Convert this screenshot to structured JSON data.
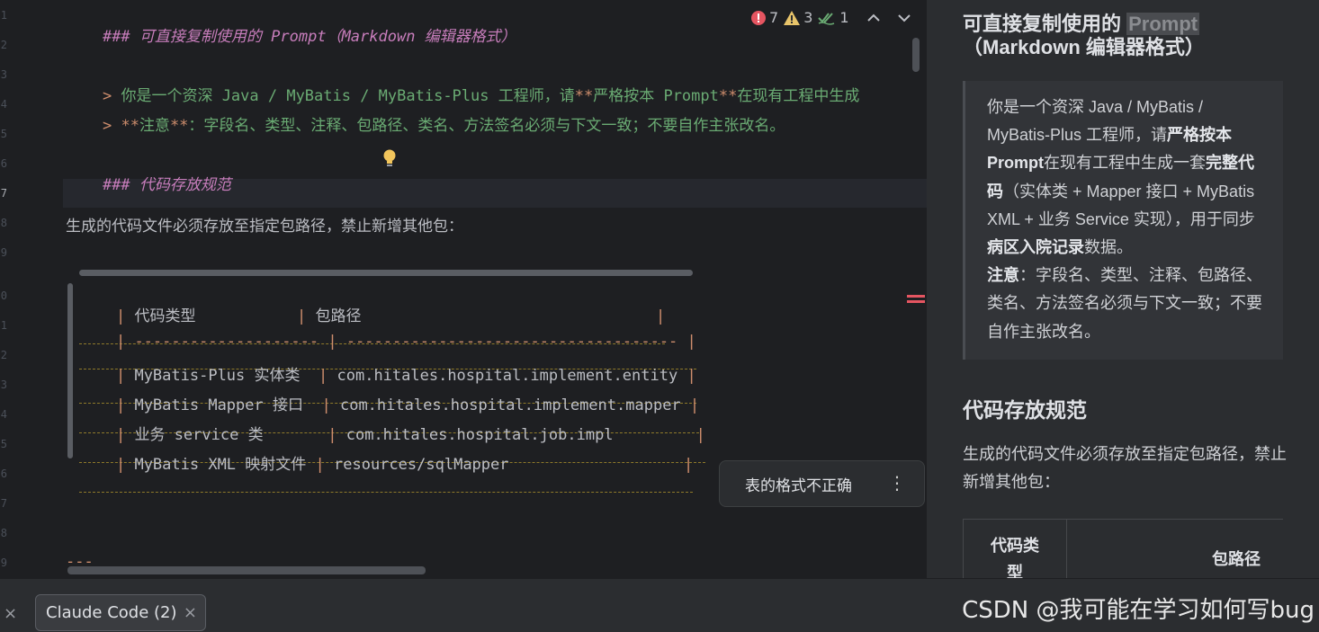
{
  "gutter": {
    "line_numbers": [
      "1",
      "2",
      "3",
      "4",
      "5",
      "6",
      "7",
      "8",
      "9",
      "0",
      "1",
      "2",
      "3",
      "4",
      "5",
      "6",
      "7",
      "8",
      "9"
    ]
  },
  "editor": {
    "line1": {
      "marker": "###",
      "text": "可直接复制使用的 Prompt（Markdown 编辑器格式）"
    },
    "line3": {
      "marker": ">",
      "pre": "你是一个资深 Java / MyBatis / MyBatis-Plus 工程师，请",
      "stars": "**",
      "mid": "严格按本 Prompt",
      "stars2": "**",
      "post": "在现有工程中生成"
    },
    "line4": {
      "marker": ">",
      "stars": "**",
      "mid": "注意",
      "stars2": "**",
      "post": "：字段名、类型、注释、包路径、类名、方法签名必须与下文一致；不要自作主张改名。"
    },
    "line6": {
      "marker": "###",
      "text": "代码存放规范"
    },
    "line8": "生成的代码文件必须存放至指定包路径，禁止新增其他包：",
    "table": [
      {
        "c1": "代码类型",
        "c2": "包路径",
        "pad1": "           ",
        "pad2": "                                "
      },
      {
        "raw": "-------------------- | ------------------------------------"
      },
      {
        "c1": "MyBatis-Plus 实体类",
        "c2": "com.hitales.hospital.implement.entity"
      },
      {
        "c1": "MyBatis Mapper 接口",
        "c2": "com.hitales.hospital.implement.mapper"
      },
      {
        "c1": "业务 service 类",
        "c2": "com.hitales.hospital.job.impl"
      },
      {
        "c1": "MyBatis XML 映射文件",
        "c2": "resources/sqlMapper"
      }
    ],
    "hr": "---",
    "inspections": {
      "errors": "7",
      "warnings": "3",
      "ok": "1"
    },
    "tooltip": {
      "text": "表的格式不正确",
      "more": "⋮"
    }
  },
  "preview": {
    "h1_pre": "可直接复制使用的 ",
    "h1_code": "Prompt",
    "h1_post": "（Markdown 编辑器格式）",
    "quote": {
      "p1": "你是一个资深 Java / MyBatis / MyBatis-Plus 工程师，请",
      "b1": "严格按本 Prompt",
      "p2": "在现有工程中生成一套",
      "b2": "完整代码",
      "p3": "（实体类 + Mapper 接口 + MyBatis XML + 业务 Service 实现），用于同步",
      "b3": "病区入院记录",
      "p4": "数据。",
      "b4": "注意",
      "p5": "：字段名、类型、注释、包路径、类名、方法签名必须与下文一致；不要自作主张改名。"
    },
    "h2": "代码存放规范",
    "para": "生成的代码文件必须存放至指定包路径，禁止新增其他包：",
    "table_h1": "代码类型",
    "table_h2": "包路径"
  },
  "bottom": {
    "close_glyph": "×",
    "tab_label": "Claude Code (2)",
    "tab_close": "×",
    "watermark": "CSDN @我可能在学习如何写bug"
  },
  "colors": {
    "error": "#e55561",
    "warning": "#e8c46a",
    "ok": "#6aab73",
    "accent_bold": "#cf8e6d"
  }
}
